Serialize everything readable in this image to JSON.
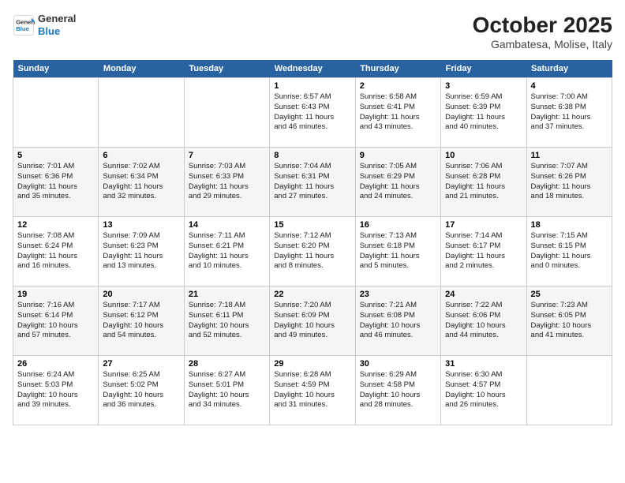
{
  "logo": {
    "line1": "General",
    "line2": "Blue"
  },
  "title": "October 2025",
  "subtitle": "Gambatesa, Molise, Italy",
  "days_of_week": [
    "Sunday",
    "Monday",
    "Tuesday",
    "Wednesday",
    "Thursday",
    "Friday",
    "Saturday"
  ],
  "weeks": [
    [
      {
        "day": "",
        "info": ""
      },
      {
        "day": "",
        "info": ""
      },
      {
        "day": "",
        "info": ""
      },
      {
        "day": "1",
        "info": "Sunrise: 6:57 AM\nSunset: 6:43 PM\nDaylight: 11 hours\nand 46 minutes."
      },
      {
        "day": "2",
        "info": "Sunrise: 6:58 AM\nSunset: 6:41 PM\nDaylight: 11 hours\nand 43 minutes."
      },
      {
        "day": "3",
        "info": "Sunrise: 6:59 AM\nSunset: 6:39 PM\nDaylight: 11 hours\nand 40 minutes."
      },
      {
        "day": "4",
        "info": "Sunrise: 7:00 AM\nSunset: 6:38 PM\nDaylight: 11 hours\nand 37 minutes."
      }
    ],
    [
      {
        "day": "5",
        "info": "Sunrise: 7:01 AM\nSunset: 6:36 PM\nDaylight: 11 hours\nand 35 minutes."
      },
      {
        "day": "6",
        "info": "Sunrise: 7:02 AM\nSunset: 6:34 PM\nDaylight: 11 hours\nand 32 minutes."
      },
      {
        "day": "7",
        "info": "Sunrise: 7:03 AM\nSunset: 6:33 PM\nDaylight: 11 hours\nand 29 minutes."
      },
      {
        "day": "8",
        "info": "Sunrise: 7:04 AM\nSunset: 6:31 PM\nDaylight: 11 hours\nand 27 minutes."
      },
      {
        "day": "9",
        "info": "Sunrise: 7:05 AM\nSunset: 6:29 PM\nDaylight: 11 hours\nand 24 minutes."
      },
      {
        "day": "10",
        "info": "Sunrise: 7:06 AM\nSunset: 6:28 PM\nDaylight: 11 hours\nand 21 minutes."
      },
      {
        "day": "11",
        "info": "Sunrise: 7:07 AM\nSunset: 6:26 PM\nDaylight: 11 hours\nand 18 minutes."
      }
    ],
    [
      {
        "day": "12",
        "info": "Sunrise: 7:08 AM\nSunset: 6:24 PM\nDaylight: 11 hours\nand 16 minutes."
      },
      {
        "day": "13",
        "info": "Sunrise: 7:09 AM\nSunset: 6:23 PM\nDaylight: 11 hours\nand 13 minutes."
      },
      {
        "day": "14",
        "info": "Sunrise: 7:11 AM\nSunset: 6:21 PM\nDaylight: 11 hours\nand 10 minutes."
      },
      {
        "day": "15",
        "info": "Sunrise: 7:12 AM\nSunset: 6:20 PM\nDaylight: 11 hours\nand 8 minutes."
      },
      {
        "day": "16",
        "info": "Sunrise: 7:13 AM\nSunset: 6:18 PM\nDaylight: 11 hours\nand 5 minutes."
      },
      {
        "day": "17",
        "info": "Sunrise: 7:14 AM\nSunset: 6:17 PM\nDaylight: 11 hours\nand 2 minutes."
      },
      {
        "day": "18",
        "info": "Sunrise: 7:15 AM\nSunset: 6:15 PM\nDaylight: 11 hours\nand 0 minutes."
      }
    ],
    [
      {
        "day": "19",
        "info": "Sunrise: 7:16 AM\nSunset: 6:14 PM\nDaylight: 10 hours\nand 57 minutes."
      },
      {
        "day": "20",
        "info": "Sunrise: 7:17 AM\nSunset: 6:12 PM\nDaylight: 10 hours\nand 54 minutes."
      },
      {
        "day": "21",
        "info": "Sunrise: 7:18 AM\nSunset: 6:11 PM\nDaylight: 10 hours\nand 52 minutes."
      },
      {
        "day": "22",
        "info": "Sunrise: 7:20 AM\nSunset: 6:09 PM\nDaylight: 10 hours\nand 49 minutes."
      },
      {
        "day": "23",
        "info": "Sunrise: 7:21 AM\nSunset: 6:08 PM\nDaylight: 10 hours\nand 46 minutes."
      },
      {
        "day": "24",
        "info": "Sunrise: 7:22 AM\nSunset: 6:06 PM\nDaylight: 10 hours\nand 44 minutes."
      },
      {
        "day": "25",
        "info": "Sunrise: 7:23 AM\nSunset: 6:05 PM\nDaylight: 10 hours\nand 41 minutes."
      }
    ],
    [
      {
        "day": "26",
        "info": "Sunrise: 6:24 AM\nSunset: 5:03 PM\nDaylight: 10 hours\nand 39 minutes."
      },
      {
        "day": "27",
        "info": "Sunrise: 6:25 AM\nSunset: 5:02 PM\nDaylight: 10 hours\nand 36 minutes."
      },
      {
        "day": "28",
        "info": "Sunrise: 6:27 AM\nSunset: 5:01 PM\nDaylight: 10 hours\nand 34 minutes."
      },
      {
        "day": "29",
        "info": "Sunrise: 6:28 AM\nSunset: 4:59 PM\nDaylight: 10 hours\nand 31 minutes."
      },
      {
        "day": "30",
        "info": "Sunrise: 6:29 AM\nSunset: 4:58 PM\nDaylight: 10 hours\nand 28 minutes."
      },
      {
        "day": "31",
        "info": "Sunrise: 6:30 AM\nSunset: 4:57 PM\nDaylight: 10 hours\nand 26 minutes."
      },
      {
        "day": "",
        "info": ""
      }
    ]
  ]
}
